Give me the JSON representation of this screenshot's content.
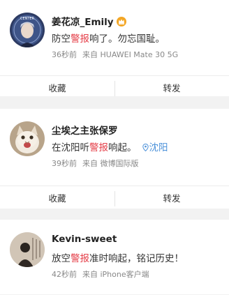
{
  "posts": [
    {
      "username": "姜花凉_Emily",
      "content": {
        "before": "防空",
        "highlight": "警报",
        "after": "响了。勿忘国耻。"
      },
      "time": "36秒前",
      "source": "来自 HUAWEI Mate 30 5G",
      "badge_icon": "crown-icon",
      "avatar_text": "CENTER",
      "actions": {
        "collect": "收藏",
        "repost": "转发"
      }
    },
    {
      "username": "尘埃之主张保罗",
      "content": {
        "before": "在沈阳听",
        "highlight": "警报",
        "after": "响起。"
      },
      "location": "沈阳",
      "time": "39秒前",
      "source": "来自 微博国际版",
      "actions": {
        "collect": "收藏",
        "repost": "转发"
      }
    },
    {
      "username": "Kevin-sweet",
      "content": {
        "before": "放空",
        "highlight": "警报",
        "after": "准时响起，铭记历史！"
      },
      "time": "42秒前",
      "source": "来自 iPhone客户端"
    }
  ],
  "colors": {
    "highlight": "#e5404a",
    "location": "#4a90d9",
    "meta": "#888888",
    "background": "#f2f2f2"
  }
}
